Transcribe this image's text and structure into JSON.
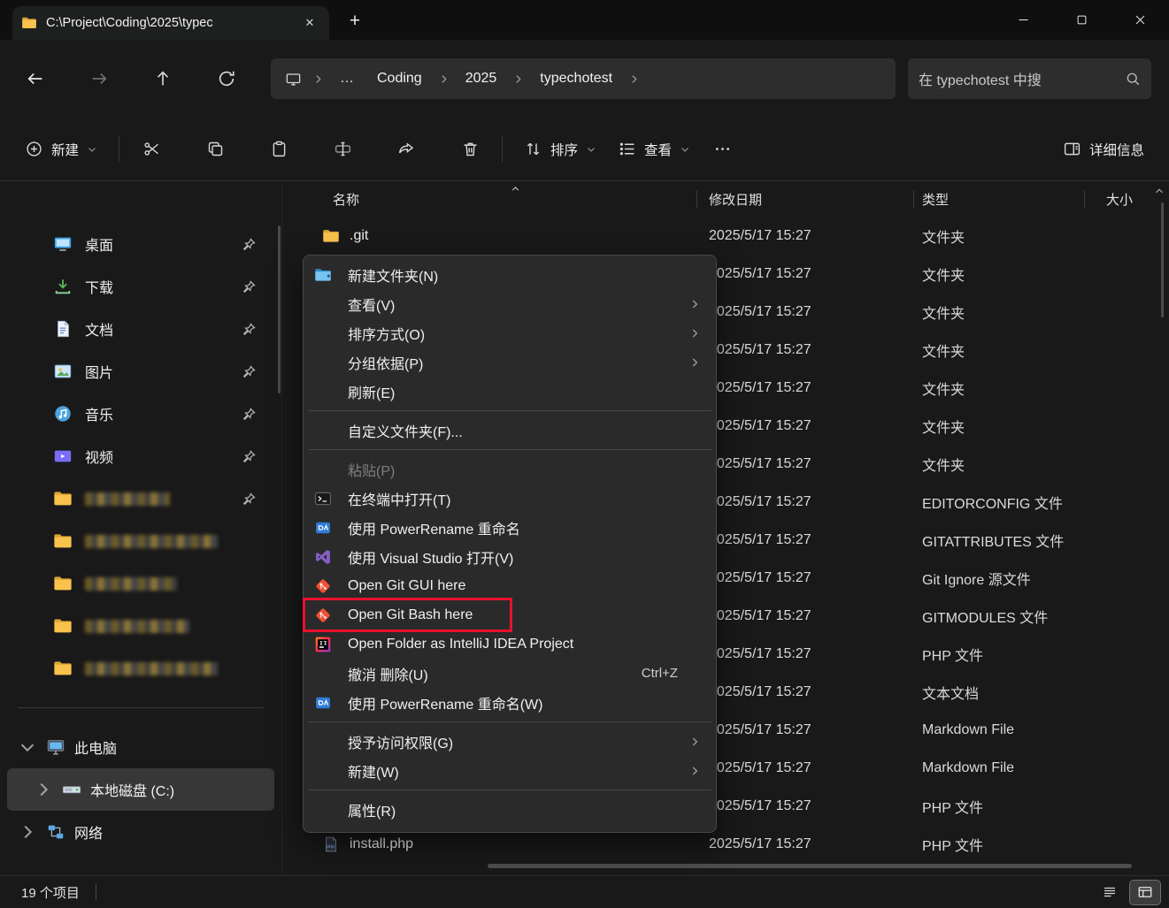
{
  "window": {
    "tab_title": "C:\\Project\\Coding\\2025\\typec",
    "close_tab": "✕",
    "new_tab": "+"
  },
  "navbar": {
    "breadcrumb_overflow": "…",
    "crumbs": [
      "Coding",
      "2025",
      "typechotest"
    ],
    "search_text": "在 typechotest 中搜"
  },
  "toolbar": {
    "new_label": "新建",
    "sort_label": "排序",
    "view_label": "查看",
    "details_label": "详细信息"
  },
  "sidebar": {
    "pinned": [
      {
        "label": "桌面",
        "icon": "desktop",
        "pin": true
      },
      {
        "label": "下载",
        "icon": "downloads",
        "pin": true
      },
      {
        "label": "文档",
        "icon": "documents",
        "pin": true
      },
      {
        "label": "图片",
        "icon": "pictures",
        "pin": true
      },
      {
        "label": "音乐",
        "icon": "music",
        "pin": true
      },
      {
        "label": "视频",
        "icon": "videos",
        "pin": true
      },
      {
        "label": "",
        "icon": "folder",
        "redacted": true,
        "redact_width": 96,
        "pin": true
      },
      {
        "label": "",
        "icon": "folder",
        "redacted": true,
        "redact_width": 150
      },
      {
        "label": "",
        "icon": "folder",
        "redacted": true,
        "redact_width": 104
      },
      {
        "label": "",
        "icon": "folder",
        "redacted": true,
        "redact_width": 118
      },
      {
        "label": "",
        "icon": "folder",
        "redacted": true,
        "redact_width": 150
      }
    ],
    "tree": [
      {
        "label": "此电脑",
        "icon": "pc",
        "chevron": "down",
        "indent": 0,
        "selected": false
      },
      {
        "label": "本地磁盘 (C:)",
        "icon": "disk",
        "chevron": "right",
        "indent": 1,
        "selected": true
      },
      {
        "label": "网络",
        "icon": "network",
        "chevron": "right",
        "indent": 0,
        "selected": false
      }
    ]
  },
  "filelist": {
    "columns": [
      "名称",
      "修改日期",
      "类型",
      "大小"
    ],
    "rows": [
      {
        "name": ".git",
        "icon": "folder",
        "date": "2025/5/17 15:27",
        "type": "文件夹",
        "size": ""
      },
      {
        "name": "",
        "icon": "",
        "date": "2025/5/17 15:27",
        "type": "文件夹",
        "size": ""
      },
      {
        "name": "",
        "icon": "",
        "date": "2025/5/17 15:27",
        "type": "文件夹",
        "size": ""
      },
      {
        "name": "",
        "icon": "",
        "date": "2025/5/17 15:27",
        "type": "文件夹",
        "size": ""
      },
      {
        "name": "",
        "icon": "",
        "date": "2025/5/17 15:27",
        "type": "文件夹",
        "size": ""
      },
      {
        "name": "",
        "icon": "",
        "date": "2025/5/17 15:27",
        "type": "文件夹",
        "size": ""
      },
      {
        "name": "",
        "icon": "",
        "date": "2025/5/17 15:27",
        "type": "文件夹",
        "size": ""
      },
      {
        "name": "",
        "icon": "",
        "date": "2025/5/17 15:27",
        "type": "EDITORCONFIG 文件",
        "size": ""
      },
      {
        "name": "",
        "icon": "",
        "date": "2025/5/17 15:27",
        "type": "GITATTRIBUTES 文件",
        "size": ""
      },
      {
        "name": "",
        "icon": "",
        "date": "2025/5/17 15:27",
        "type": "Git Ignore 源文件",
        "size": ""
      },
      {
        "name": "",
        "icon": "",
        "date": "2025/5/17 15:27",
        "type": "GITMODULES 文件",
        "size": ""
      },
      {
        "name": "",
        "icon": "",
        "date": "2025/5/17 15:27",
        "type": "PHP 文件",
        "size": ""
      },
      {
        "name": "",
        "icon": "",
        "date": "2025/5/17 15:27",
        "type": "文本文档",
        "size": ""
      },
      {
        "name": "",
        "icon": "",
        "date": "2025/5/17 15:27",
        "type": "Markdown File",
        "size": ""
      },
      {
        "name": "",
        "icon": "",
        "date": "2025/5/17 15:27",
        "type": "Markdown File",
        "size": ""
      },
      {
        "name": "",
        "icon": "",
        "date": "2025/5/17 15:27",
        "type": "PHP 文件",
        "size": ""
      },
      {
        "name": "install.php",
        "icon": "file-php",
        "date": "2025/5/17 15:27",
        "type": "PHP 文件",
        "size": ""
      }
    ]
  },
  "context_menu": {
    "items": [
      {
        "label": "新建文件夹(N)",
        "icon": "new-folder"
      },
      {
        "label": "查看(V)",
        "submenu": true
      },
      {
        "label": "排序方式(O)",
        "submenu": true
      },
      {
        "label": "分组依据(P)",
        "submenu": true
      },
      {
        "label": "刷新(E)"
      },
      {
        "type": "separator"
      },
      {
        "label": "自定义文件夹(F)..."
      },
      {
        "type": "separator"
      },
      {
        "label": "粘贴(P)",
        "disabled": true
      },
      {
        "label": "在终端中打开(T)",
        "icon": "terminal"
      },
      {
        "label": "使用 PowerRename 重命名",
        "icon": "powerrename"
      },
      {
        "label": "使用 Visual Studio 打开(V)",
        "icon": "visual-studio"
      },
      {
        "label": "Open Git GUI here",
        "icon": "git"
      },
      {
        "label": "Open Git Bash here",
        "icon": "git",
        "annotated": true
      },
      {
        "label": "Open Folder as IntelliJ IDEA Project",
        "icon": "intellij"
      },
      {
        "label": "撤消 删除(U)",
        "shortcut": "Ctrl+Z"
      },
      {
        "label": "使用 PowerRename 重命名(W)",
        "icon": "powerrename"
      },
      {
        "type": "separator"
      },
      {
        "label": "授予访问权限(G)",
        "submenu": true
      },
      {
        "label": "新建(W)",
        "submenu": true
      },
      {
        "type": "separator"
      },
      {
        "label": "属性(R)"
      }
    ]
  },
  "annotation": {
    "color": "#e8112d",
    "target": "Open Git Bash here"
  },
  "statusbar": {
    "count": "19 个项目"
  }
}
